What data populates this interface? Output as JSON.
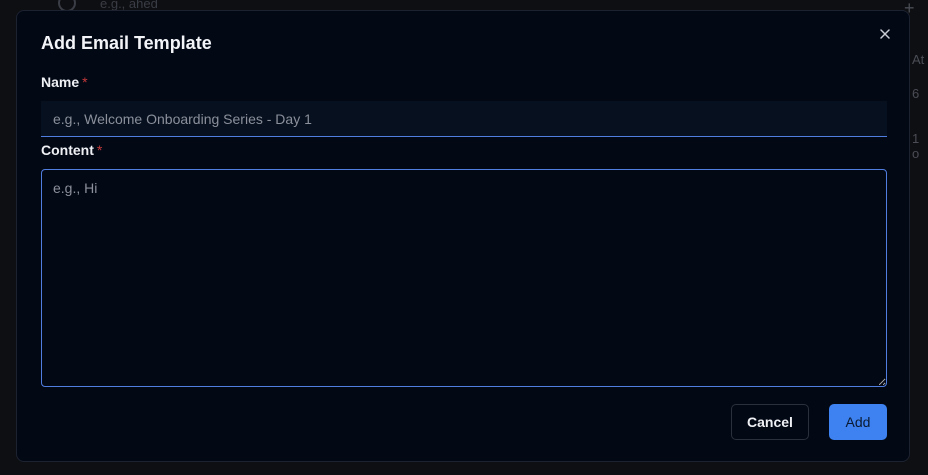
{
  "background": {
    "search_text": "e.g., ahed",
    "plus_label": "+",
    "col_header_fragment": "At",
    "col_value_fragment_1": "6",
    "col_value_fragment_2": "1 o"
  },
  "modal": {
    "title": "Add Email Template",
    "name_label": "Name",
    "name_required_mark": "*",
    "name_placeholder": "e.g., Welcome Onboarding Series - Day 1",
    "name_value": "",
    "content_label": "Content",
    "content_required_mark": "*",
    "content_placeholder": "e.g., Hi",
    "content_value": "",
    "cancel_label": "Cancel",
    "add_label": "Add"
  },
  "colors": {
    "accent": "#3d82f0",
    "modal_bg": "#030815",
    "required": "#c53a3a"
  },
  "icons": {
    "close": "close-icon",
    "search": "search-icon"
  }
}
